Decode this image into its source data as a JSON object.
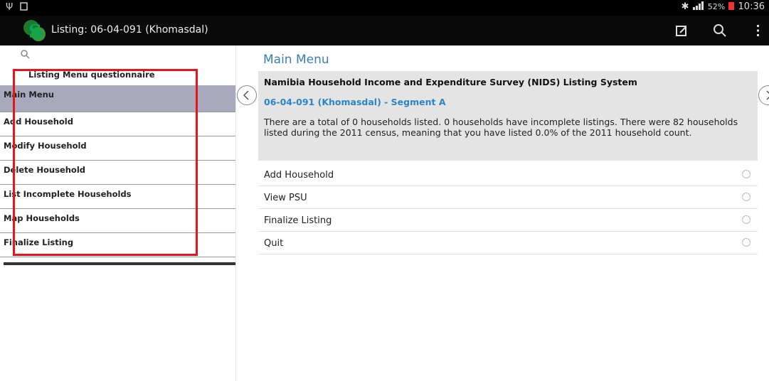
{
  "status_bar": {
    "usb_icon": "usb-icon",
    "battery_percent": "52%",
    "time": "10:36"
  },
  "action_bar": {
    "title": "Listing: 06-04-091 (Khomasdal)",
    "icons": [
      "compose-icon",
      "search-icon",
      "overflow-menu-icon"
    ]
  },
  "sidebar": {
    "header": "Listing Menu questionnaire",
    "items": [
      {
        "label": "Main Menu"
      },
      {
        "label": "Add Household"
      },
      {
        "label": "Modify Household"
      },
      {
        "label": "Delete Household"
      },
      {
        "label": "List Incomplete Households"
      },
      {
        "label": "Map Households"
      },
      {
        "label": "Finalize Listing"
      }
    ],
    "highlight_color": "#e8141b"
  },
  "main": {
    "title": "Main Menu",
    "info": {
      "title": "Namibia Household Income and Expenditure Survey (NIDS) Listing System",
      "segment": "06-04-091 (Khomasdal) - Segment A",
      "text": "There are a total of 0 households listed. 0 households have incomplete listings. There were 82 households listed during the 2011 census, meaning that you have listed 0.0% of the 2011 household count."
    },
    "menu": [
      {
        "label": "Add Household"
      },
      {
        "label": "View PSU"
      },
      {
        "label": "Finalize Listing"
      },
      {
        "label": "Quit"
      }
    ]
  },
  "colors": {
    "accent": "#3a7fb0",
    "segment": "#2b86c5",
    "active_item": "#a9a9be"
  }
}
